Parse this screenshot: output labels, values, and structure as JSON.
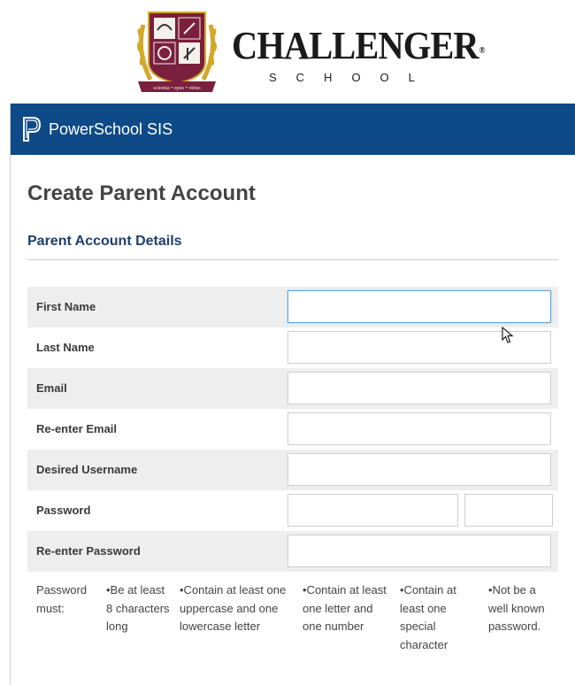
{
  "brand": {
    "name": "CHALLENGER",
    "registered": "®",
    "subtitle": "SCHOOL",
    "crest_motto": "scientia • opus • virtus"
  },
  "header": {
    "app_name": "PowerSchool SIS"
  },
  "page": {
    "title": "Create Parent Account",
    "section_title": "Parent Account Details"
  },
  "form": {
    "first_name_label": "First Name",
    "last_name_label": "Last Name",
    "email_label": "Email",
    "reenter_email_label": "Re-enter Email",
    "username_label": "Desired Username",
    "password_label": "Password",
    "reenter_password_label": "Re-enter Password"
  },
  "password_rules": {
    "intro": "Password must:",
    "rules": [
      "•Be at least 8 characters long",
      "•Contain at least one uppercase and one lowercase letter",
      "•Contain at least one letter and one number",
      "•Contain at least one special character",
      "•Not be a well known password."
    ]
  },
  "colors": {
    "header_bg": "#0d4a87",
    "section_title": "#1c3f6e",
    "row_shade": "#eeeeee",
    "crest_maroon": "#7a1f3d",
    "crest_gold": "#d4a82a"
  }
}
